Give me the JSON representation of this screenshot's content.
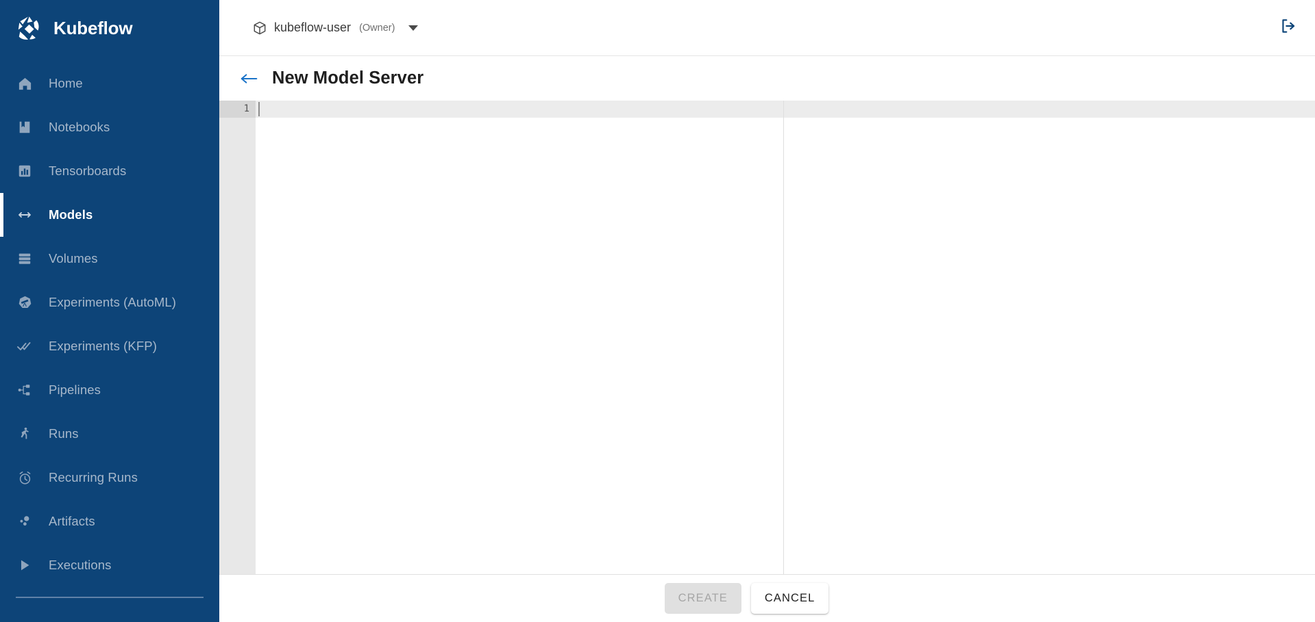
{
  "brand": {
    "name": "Kubeflow",
    "logo_icon": "kubeflow-logo-icon"
  },
  "sidebar": {
    "items": [
      {
        "label": "Home",
        "icon": "home-icon",
        "active": false
      },
      {
        "label": "Notebooks",
        "icon": "notebook-icon",
        "active": false
      },
      {
        "label": "Tensorboards",
        "icon": "bar-chart-icon",
        "active": false
      },
      {
        "label": "Models",
        "icon": "double-arrow-icon",
        "active": true
      },
      {
        "label": "Volumes",
        "icon": "storage-icon",
        "active": false
      },
      {
        "label": "Experiments (AutoML)",
        "icon": "telescope-icon",
        "active": false
      },
      {
        "label": "Experiments (KFP)",
        "icon": "double-check-icon",
        "active": false
      },
      {
        "label": "Pipelines",
        "icon": "pipeline-icon",
        "active": false
      },
      {
        "label": "Runs",
        "icon": "runner-icon",
        "active": false
      },
      {
        "label": "Recurring Runs",
        "icon": "alarm-clock-icon",
        "active": false
      },
      {
        "label": "Artifacts",
        "icon": "artifact-dots-icon",
        "active": false
      },
      {
        "label": "Executions",
        "icon": "play-triangle-icon",
        "active": false
      }
    ]
  },
  "topbar": {
    "namespace_icon": "cube-package-icon",
    "namespace": "kubeflow-user",
    "role": "(Owner)",
    "caret_icon": "chevron-down-icon",
    "logout_icon": "logout-icon"
  },
  "page": {
    "back_icon": "back-arrow-icon",
    "title": "New Model Server"
  },
  "editor": {
    "line_numbers": [
      "1"
    ],
    "content": "",
    "active_line": 1
  },
  "footer": {
    "create_label": "CREATE",
    "create_disabled": true,
    "cancel_label": "CANCEL"
  },
  "colors": {
    "sidebar_bg": "#0d4478",
    "accent_link": "#1a73c8",
    "active_text": "#ffffff",
    "inactive_text": "#a7b8cb",
    "gutter_bg": "#e8e8e8",
    "active_line_bg": "#ececec"
  }
}
